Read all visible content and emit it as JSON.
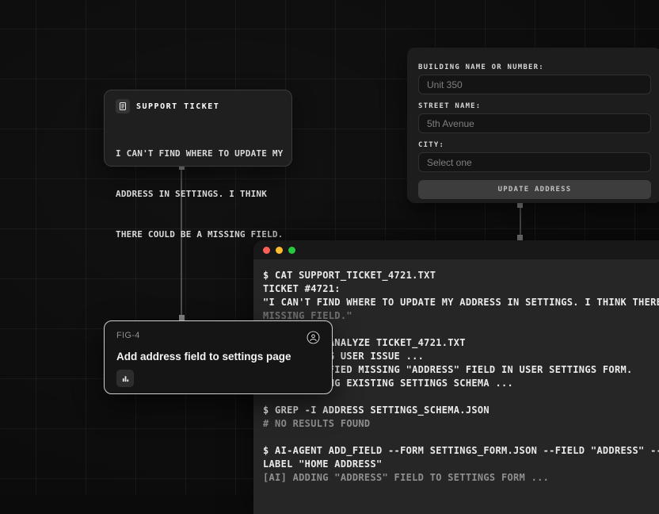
{
  "support_ticket": {
    "icon": "ticket-icon",
    "title": "SUPPORT TICKET",
    "body_lines": [
      "I CAN'T FIND WHERE TO UPDATE MY",
      "ADDRESS IN SETTINGS. I THINK",
      "THERE COULD BE A MISSING FIELD."
    ]
  },
  "fig_card": {
    "label": "FIG-4",
    "title": "Add address field to settings page",
    "chart_icon": "bar-chart-icon",
    "avatar_icon": "person-icon"
  },
  "address_form": {
    "fields": [
      {
        "label": "BUILDING NAME OR NUMBER:",
        "value": "Unit 350"
      },
      {
        "label": "STREET NAME:",
        "value": "5th Avenue"
      },
      {
        "label": "CITY:",
        "value": "Select one"
      }
    ],
    "submit_label": "UPDATE ADDRESS"
  },
  "terminal": {
    "window_buttons": [
      "close",
      "minimize",
      "zoom"
    ],
    "lines": [
      {
        "text": "$ CAT SUPPORT_TICKET_4721.TXT",
        "style": "bright"
      },
      {
        "text": "TICKET #4721:",
        "style": "bright"
      },
      {
        "text": "\"I CAN'T FIND WHERE TO UPDATE MY ADDRESS IN SETTINGS. I THINK THERE COULD BE A",
        "style": "bright"
      },
      {
        "text": "MISSING FIELD.\"",
        "style": "faded"
      },
      {
        "text": "",
        "style": "bright"
      },
      {
        "text": "$ AI-AGENT ANALYZE TICKET_4721.TXT",
        "style": "bright"
      },
      {
        "text": "[AI] READING USER ISSUE ...",
        "style": "bright"
      },
      {
        "text": "[AI] IDENTIFIED MISSING \"ADDRESS\" FIELD IN USER SETTINGS FORM.",
        "style": "bright"
      },
      {
        "text": "[AI] CHECKING EXISTING SETTINGS SCHEMA ...",
        "style": "bright"
      },
      {
        "text": "",
        "style": "bright"
      },
      {
        "text": "$ GREP -I ADDRESS SETTINGS_SCHEMA.JSON",
        "style": "bright"
      },
      {
        "text": "# NO RESULTS FOUND",
        "style": "dim"
      },
      {
        "text": "",
        "style": "bright"
      },
      {
        "text": "$ AI-AGENT ADD_FIELD --FORM SETTINGS_FORM.JSON --FIELD \"ADDRESS\" --TYPE TEXT --",
        "style": "bright"
      },
      {
        "text": "LABEL \"HOME ADDRESS\"",
        "style": "bright"
      },
      {
        "text": "[AI] ADDING \"ADDRESS\" FIELD TO SETTINGS FORM ...",
        "style": "dim"
      }
    ]
  },
  "colors": {
    "canvas_bg": "#0c0c0c",
    "card_bg": "#1f1f1f",
    "panel_bg": "#1d1d1d",
    "terminal_bg": "#262626",
    "titlebar_bg": "#181818",
    "traffic_red": "#ff5f57",
    "traffic_yellow": "#febc2e",
    "traffic_green": "#28c840",
    "text_bright": "#eaeaea",
    "text_dim": "#8f8f8f"
  }
}
